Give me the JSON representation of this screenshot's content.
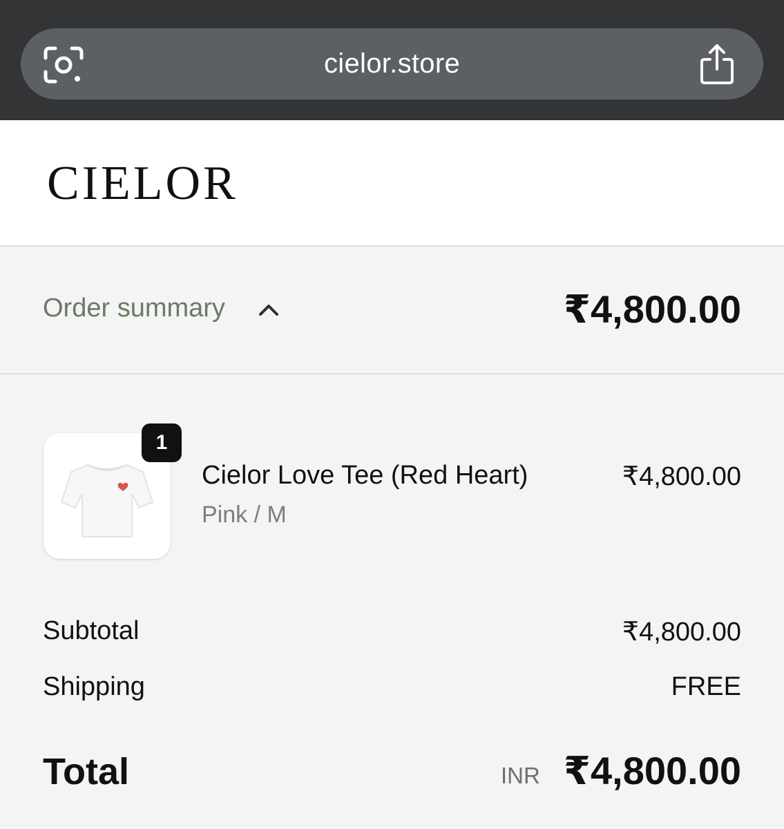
{
  "browser": {
    "url": "cielor.store",
    "lens_icon": "camera-lens-icon",
    "share_icon": "share-icon"
  },
  "store": {
    "logo": "CIELOR"
  },
  "summary": {
    "label": "Order summary",
    "chevron_icon": "chevron-up-icon",
    "total": "₹4,800.00"
  },
  "cart": {
    "items": [
      {
        "quantity": "1",
        "name": "Cielor Love Tee (Red Heart)",
        "variant": "Pink / M",
        "price": "₹4,800.00",
        "image_icon": "white-tshirt-icon"
      }
    ]
  },
  "totals": {
    "subtotal_label": "Subtotal",
    "subtotal_value": "₹4,800.00",
    "shipping_label": "Shipping",
    "shipping_value": "FREE",
    "total_label": "Total",
    "currency": "INR",
    "total_value": "₹4,800.00"
  },
  "colors": {
    "browser_bar": "#333436",
    "url_pill": "#5c5f63",
    "summary_label": "#6b7a63",
    "badge": "#111111",
    "heart": "#d9534f"
  }
}
